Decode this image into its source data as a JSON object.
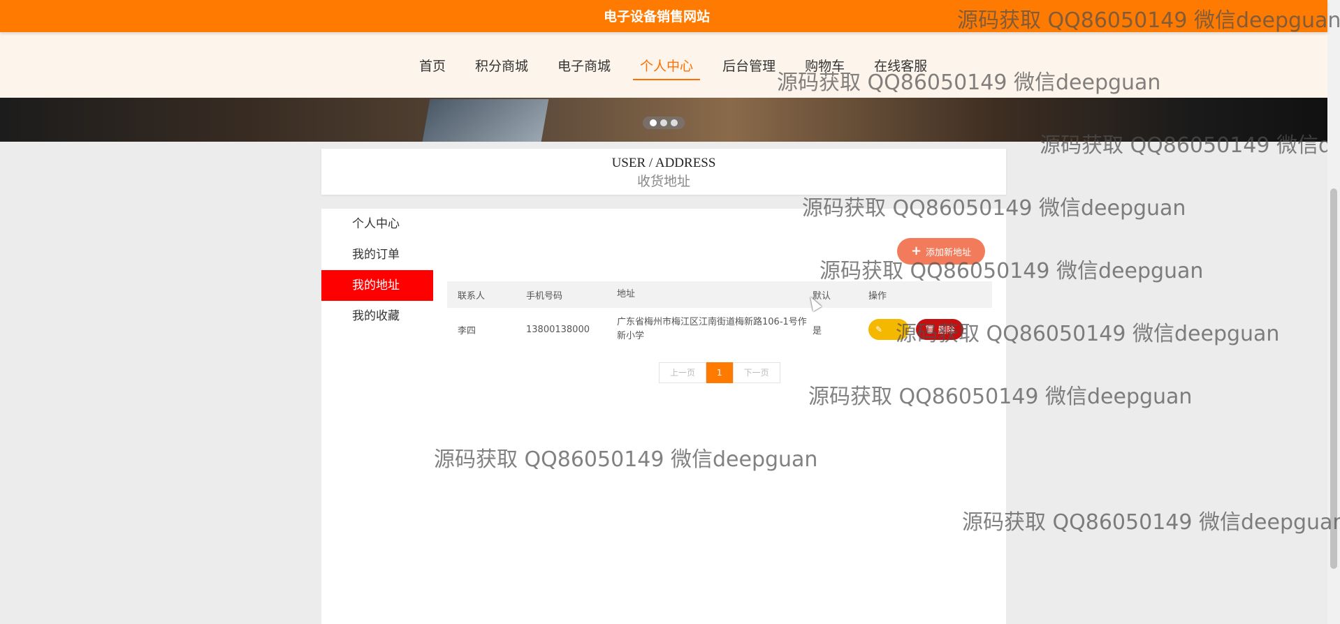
{
  "header": {
    "site_title": "电子设备销售网站"
  },
  "nav": {
    "items": [
      {
        "label": "首页"
      },
      {
        "label": "积分商城"
      },
      {
        "label": "电子商城"
      },
      {
        "label": "个人中心"
      },
      {
        "label": "后台管理"
      },
      {
        "label": "购物车"
      },
      {
        "label": "在线客服"
      }
    ],
    "active": "个人中心"
  },
  "banner": {
    "slides": 3,
    "active_slide": 1
  },
  "page_heading": {
    "en": "USER / ADDRESS",
    "cn": "收货地址"
  },
  "sidebar": {
    "items": [
      {
        "label": "个人中心"
      },
      {
        "label": "我的订单"
      },
      {
        "label": "我的地址"
      },
      {
        "label": "我的收藏"
      }
    ],
    "active": "我的地址"
  },
  "actions": {
    "add_address": "添加新地址"
  },
  "table": {
    "headers": [
      "联系人",
      "手机号码",
      "地址",
      "默认",
      "操作"
    ],
    "rows": [
      {
        "contact": "李四",
        "phone": "13800138000",
        "address": "广东省梅州市梅江区江南街道梅新路106-1号作新小学",
        "default": "是",
        "delete_label": "删除"
      }
    ]
  },
  "pagination": {
    "prev": "上一页",
    "current": "1",
    "next": "下一页"
  },
  "watermark": {
    "text": "源码获取 QQ86050149 微信deepguan"
  },
  "colors": {
    "brand": "#ff7a00",
    "active_menu": "#ff0000",
    "edit": "#f5b800",
    "delete": "#c41010"
  }
}
